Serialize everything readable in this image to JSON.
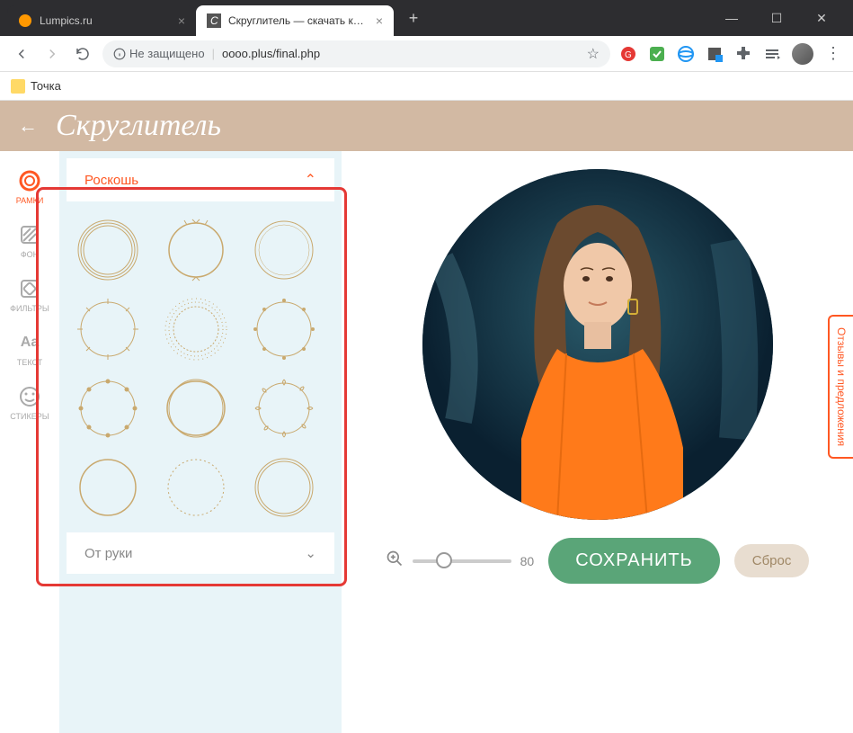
{
  "browser": {
    "tabs": [
      {
        "title": "Lumpics.ru",
        "active": false
      },
      {
        "title": "Скруглитель — скачать круглу...",
        "active": true
      }
    ],
    "security_label": "Не защищено",
    "url": "oooo.plus/final.php",
    "bookmark": "Точка"
  },
  "app": {
    "title": "Скруглитель"
  },
  "sidebar": {
    "tabs": [
      {
        "label": "РАМКИ",
        "icon": "frames"
      },
      {
        "label": "ФОН",
        "icon": "background"
      },
      {
        "label": "ФИЛЬТРЫ",
        "icon": "filters"
      },
      {
        "label": "ТЕКСТ",
        "icon": "text"
      },
      {
        "label": "СТИКЕРЫ",
        "icon": "stickers"
      }
    ],
    "category_open": "Роскошь",
    "category_closed": "От руки"
  },
  "controls": {
    "zoom_value": "80",
    "save_label": "СОХРАНИТЬ",
    "reset_label": "Сброс"
  },
  "feedback_label": "Отзывы и предложения"
}
